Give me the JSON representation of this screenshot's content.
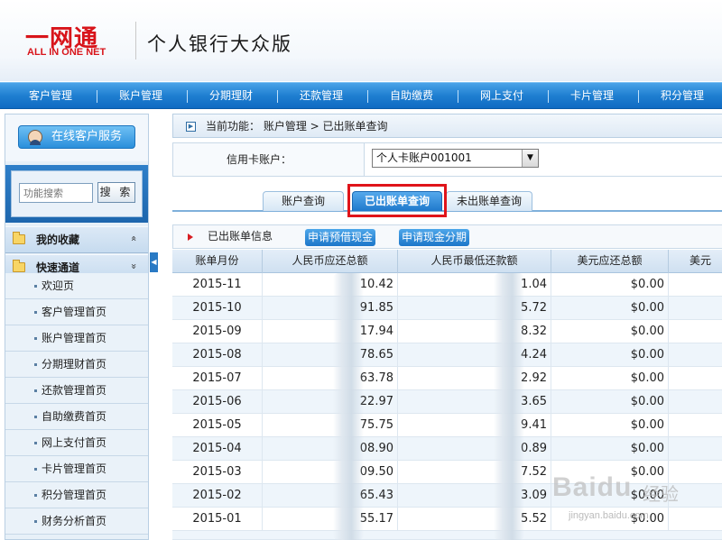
{
  "header": {
    "logo_cn": "一网通",
    "logo_en": "ALL IN ONE NET",
    "site_title": "个人银行大众版"
  },
  "nav": {
    "items": [
      "客户管理",
      "账户管理",
      "分期理财",
      "还款管理",
      "自助缴费",
      "网上支付",
      "卡片管理",
      "积分管理"
    ]
  },
  "sidebar": {
    "service_button": "在线客户服务",
    "search": {
      "placeholder": "功能搜索",
      "button": "搜 索"
    },
    "favorites": {
      "label": "我的收藏",
      "chevron": "«"
    },
    "quick": {
      "label": "快速通道",
      "chevron": "»"
    },
    "items": [
      "欢迎页",
      "客户管理首页",
      "账户管理首页",
      "分期理财首页",
      "还款管理首页",
      "自助缴费首页",
      "网上支付首页",
      "卡片管理首页",
      "积分管理首页",
      "财务分析首页"
    ]
  },
  "main": {
    "breadcrumb": "当前功能： 账户管理 > 已出账单查询",
    "account": {
      "label": "信用卡账户：",
      "selected": "个人卡账户001001"
    },
    "tabs": [
      "账户查询",
      "已出账单查询",
      "未出账单查询"
    ],
    "active_tab": 1,
    "info": {
      "label": "已出账单信息",
      "btn_cash_advance": "申请预借现金",
      "btn_cash_installment": "申请现金分期"
    },
    "table": {
      "columns": [
        "账单月份",
        "人民币应还总额",
        "人民币最低还款额",
        "美元应还总额",
        "美元"
      ],
      "rows": [
        {
          "month": "2015-11",
          "cny_total": "10.42",
          "cny_min": "1.04",
          "usd_total": "$0.00"
        },
        {
          "month": "2015-10",
          "cny_total": "91.85",
          "cny_min": "5.72",
          "usd_total": "$0.00"
        },
        {
          "month": "2015-09",
          "cny_total": "17.94",
          "cny_min": "8.32",
          "usd_total": "$0.00"
        },
        {
          "month": "2015-08",
          "cny_total": "78.65",
          "cny_min": "4.24",
          "usd_total": "$0.00"
        },
        {
          "month": "2015-07",
          "cny_total": "63.78",
          "cny_min": "2.92",
          "usd_total": "$0.00"
        },
        {
          "month": "2015-06",
          "cny_total": "22.97",
          "cny_min": "3.65",
          "usd_total": "$0.00"
        },
        {
          "month": "2015-05",
          "cny_total": "75.75",
          "cny_min": "9.41",
          "usd_total": "$0.00"
        },
        {
          "month": "2015-04",
          "cny_total": "08.90",
          "cny_min": "0.89",
          "usd_total": "$0.00"
        },
        {
          "month": "2015-03",
          "cny_total": "09.50",
          "cny_min": "7.52",
          "usd_total": "$0.00"
        },
        {
          "month": "2015-02",
          "cny_total": "65.43",
          "cny_min": "3.09",
          "usd_total": "$0.00"
        },
        {
          "month": "2015-01",
          "cny_total": "55.17",
          "cny_min": "5.52",
          "usd_total": "$0.00"
        }
      ]
    }
  },
  "watermark": {
    "brand": "Baidu",
    "brand_cn": "经验",
    "url": "jingyan.baidu.com"
  },
  "colors": {
    "nav_blue": "#1f7fd1",
    "brand_red": "#d8141a",
    "highlight_red": "#e0141a"
  }
}
